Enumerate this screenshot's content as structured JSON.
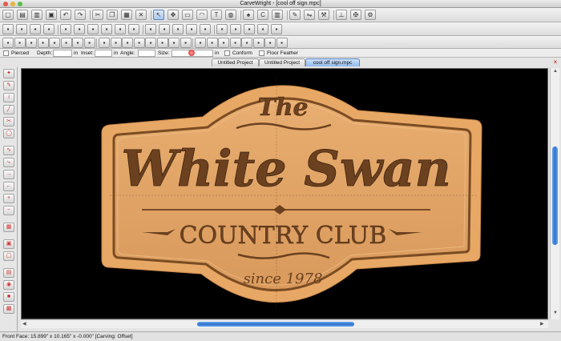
{
  "window": {
    "title": "CarveWright - [cool off sign.mpc]"
  },
  "toolbar_row1_icons": [
    "new-file-icon",
    "open-folder-icon",
    "folder-icon",
    "save-icon",
    "undo-icon",
    "redo-icon",
    "cut-icon",
    "copy-icon",
    "paste-icon",
    "delete-icon",
    "pointer-icon",
    "node-edit-icon",
    "rectangle-icon",
    "arc-icon",
    "text-icon",
    "globe-icon",
    "stamp-icon",
    "cw-icon",
    "rulers-icon",
    "draw-icon",
    "flip-icon",
    "wrench-icon",
    "carve-icon",
    "tools-icon",
    "settings-icon"
  ],
  "toolbar_row2_icons": [
    "trace-icon",
    "magnify-icon",
    "board-icon",
    "bitmap-icon",
    "depth-icon",
    "shape-icon",
    "layers-icon",
    "box-icon",
    "color-icon",
    "spray-icon",
    "pattern-icon",
    "gear-icon",
    "contour-icon",
    "stack-icon",
    "block-icon",
    "front-icon",
    "sheet-icon",
    "hatch-icon",
    "box2-icon",
    "sand-icon"
  ],
  "toolbar_row3_icons": [
    "panel-icon",
    "panel2-icon",
    "panel3-icon",
    "panel4-icon",
    "panel5-icon",
    "panel6-icon",
    "panel7-icon",
    "panel8-icon",
    "panel9-icon",
    "panel10-icon",
    "panel11-icon",
    "panel12-icon",
    "panel13-icon",
    "panel14-icon",
    "panel15-icon",
    "panel16-icon",
    "panel17-icon",
    "panel18-icon",
    "panel19-icon",
    "panel20-icon",
    "panel21-icon",
    "panel22-icon",
    "panel23-icon",
    "panel24-icon"
  ],
  "properties": {
    "pierced": "Pierced",
    "depth_label": "Depth:",
    "depth_unit": "in",
    "inset_label": "Inset:",
    "inset_unit": "in",
    "angle_label": "Angle:",
    "size_label": "Size:",
    "size_unit": "in",
    "conform": "Conform",
    "floor_feather": "Floor Feather"
  },
  "tabs": [
    {
      "label": "Untitled Project",
      "active": false
    },
    {
      "label": "Untitled Project",
      "active": false
    },
    {
      "label": "cool off sign.mpc",
      "active": true
    }
  ],
  "left_tools": [
    "figure-icon",
    "pen-icon",
    "zigzag-icon",
    "line-icon",
    "scissors-icon",
    "circle-icon",
    "curve-icon",
    "hook-icon",
    "node-in-icon",
    "node-out-icon",
    "node-add-icon",
    "node-remove-icon",
    "grid-icon",
    "layer-front-icon",
    "layer-back-icon",
    "group-icon",
    "sphere-icon",
    "block-icon",
    "texture-icon"
  ],
  "sign": {
    "line1": "The",
    "line2": "White Swan",
    "line3": "COUNTRY CLUB",
    "line4": "since 1978"
  },
  "colors": {
    "wood_edge": "#e8a865",
    "wood_face": "#dfa46a",
    "groove": "#8a5a2f",
    "letters": "#6b4120",
    "scroll_accent": "#2f74d0"
  },
  "status": {
    "text": "Front Face: 15.899\" x 10.165\" x -0.000\"   [Carving: Offset]"
  }
}
